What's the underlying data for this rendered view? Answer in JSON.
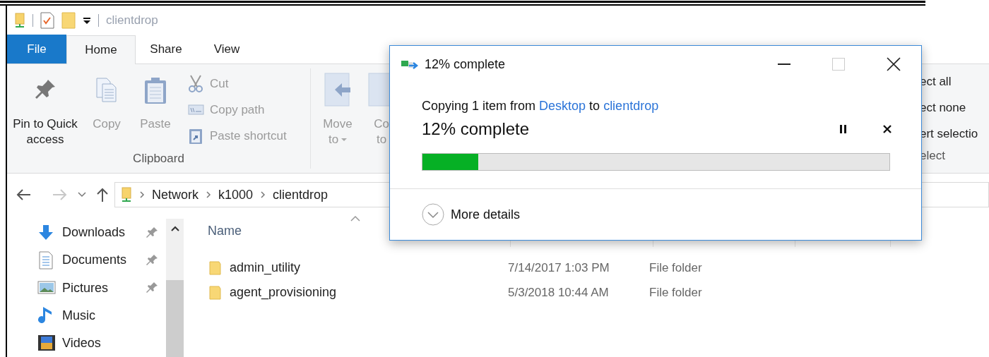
{
  "explorer": {
    "title": "clientdrop",
    "tabs": [
      {
        "label": "File",
        "kind": "file",
        "selected": false
      },
      {
        "label": "Home",
        "kind": "tab",
        "selected": true
      },
      {
        "label": "Share",
        "kind": "tab",
        "selected": false
      },
      {
        "label": "View",
        "kind": "tab",
        "selected": false
      }
    ],
    "ribbon": {
      "clipboard": {
        "large": [
          {
            "label": "Pin to Quick access",
            "kind": "pin",
            "disabled": false
          },
          {
            "label": "Copy",
            "kind": "copy",
            "disabled": true
          },
          {
            "label": "Paste",
            "kind": "paste",
            "disabled": true
          }
        ],
        "small": [
          {
            "label": "Cut",
            "kind": "cut",
            "disabled": true
          },
          {
            "label": "Copy path",
            "kind": "path",
            "disabled": true
          },
          {
            "label": "Paste shortcut",
            "kind": "shortcut",
            "disabled": true
          }
        ],
        "group_label": "Clipboard"
      },
      "organize": [
        {
          "lines": [
            "Move",
            "to"
          ],
          "dropdown": true
        },
        {
          "lines": [
            "Co",
            "to"
          ],
          "dropdown": false
        }
      ],
      "select": {
        "items": [
          "ect all",
          "ect none",
          "ert selectio"
        ],
        "group_label": "elect"
      }
    },
    "address": {
      "crumbs": [
        "Network",
        "k1000",
        "clientdrop"
      ]
    },
    "nav": [
      {
        "label": "Downloads",
        "kind": "downloads",
        "pinned": true
      },
      {
        "label": "Documents",
        "kind": "documents",
        "pinned": true
      },
      {
        "label": "Pictures",
        "kind": "pictures",
        "pinned": true
      },
      {
        "label": "Music",
        "kind": "music",
        "pinned": false
      },
      {
        "label": "Videos",
        "kind": "videos",
        "pinned": false
      }
    ],
    "list": {
      "columns": [
        "Name"
      ],
      "rows": [
        {
          "name": "admin_utility",
          "date": "7/14/2017 1:03 PM",
          "type": "File folder"
        },
        {
          "name": "agent_provisioning",
          "date": "5/3/2018 10:44 AM",
          "type": "File folder"
        }
      ]
    }
  },
  "dialog": {
    "title": "12% complete",
    "message": {
      "prefix": "Copying 1 item from",
      "source": "Desktop",
      "middle": "to",
      "destination": "clientdrop"
    },
    "heading": "12% complete",
    "progress": {
      "level": 0.12
    },
    "details": "More details"
  }
}
